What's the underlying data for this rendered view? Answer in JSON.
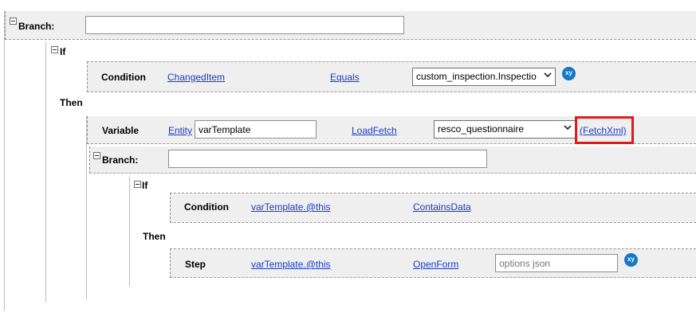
{
  "branch_outer": {
    "label": "Branch:",
    "value": ""
  },
  "if_outer": {
    "label": "If"
  },
  "condition_outer": {
    "label": "Condition",
    "left_operand": "ChangedItem",
    "operator": "Equals",
    "right_value": "custom_inspection.Inspectio",
    "xy_icon": "xy"
  },
  "then_outer": {
    "label": "Then"
  },
  "variable_row": {
    "label": "Variable",
    "type_link": "Entity",
    "name_value": "varTemplate",
    "action_link": "LoadFetch",
    "entity_value": "resco_questionnaire",
    "fetch_link": "(FetchXml)"
  },
  "branch_inner": {
    "label": "Branch:",
    "value": ""
  },
  "if_inner": {
    "label": "If"
  },
  "condition_inner": {
    "label": "Condition",
    "left_operand": "varTemplate.@this",
    "operator": "ContainsData"
  },
  "then_inner": {
    "label": "Then"
  },
  "step_row": {
    "label": "Step",
    "target": "varTemplate.@this",
    "action": "OpenForm",
    "options_placeholder": "options json",
    "options_value": "",
    "xy_icon": "xy"
  },
  "colors": {
    "highlight": "#e01b1b",
    "link": "#1a3cc8",
    "xy_badge": "#1577c8"
  }
}
